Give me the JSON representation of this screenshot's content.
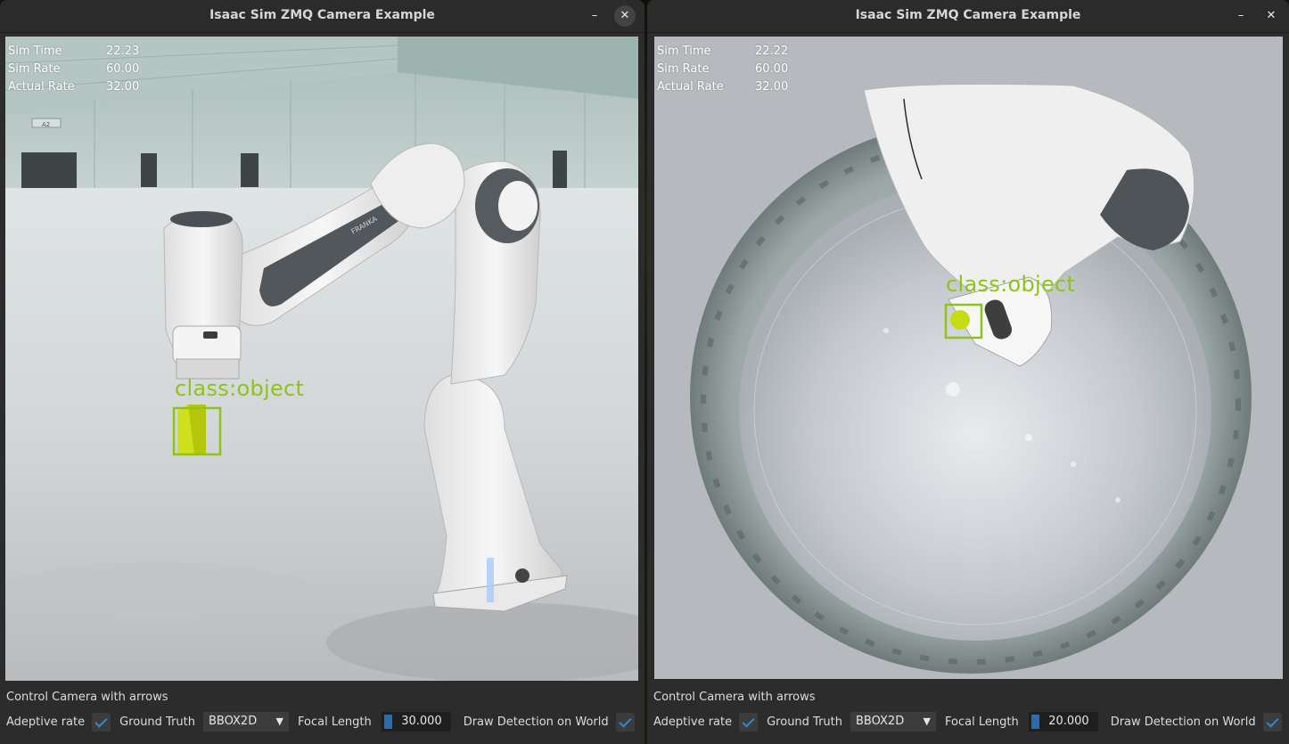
{
  "windows": [
    {
      "title": "Isaac Sim ZMQ Camera Example",
      "minimize_icon": "–",
      "close_icon": "✕",
      "stats": {
        "sim_time_label": "Sim Time",
        "sim_time": "22.23",
        "sim_rate_label": "Sim Rate",
        "sim_rate": "60.00",
        "actual_rate_label": "Actual Rate",
        "actual_rate": "32.00"
      },
      "scene_sign": "A2",
      "robot_brand": "FRANKA",
      "detection_label": "class:object",
      "controls": {
        "title": "Control Camera with arrows",
        "adaptive_rate_label": "Adeptive rate",
        "adaptive_rate_checked": true,
        "ground_truth_label": "Ground Truth",
        "ground_truth_value": "BBOX2D",
        "focal_length_label": "Focal Length",
        "focal_length_value": "30.000",
        "draw_detection_label": "Draw Detection on World",
        "draw_detection_checked": true
      }
    },
    {
      "title": "Isaac Sim ZMQ Camera Example",
      "minimize_icon": "–",
      "close_icon": "✕",
      "stats": {
        "sim_time_label": "Sim Time",
        "sim_time": "22.22",
        "sim_rate_label": "Sim Rate",
        "sim_rate": "60.00",
        "actual_rate_label": "Actual Rate",
        "actual_rate": "32.00"
      },
      "detection_label": "class:object",
      "controls": {
        "title": "Control Camera with arrows",
        "adaptive_rate_label": "Adeptive rate",
        "adaptive_rate_checked": true,
        "ground_truth_label": "Ground Truth",
        "ground_truth_value": "BBOX2D",
        "focal_length_label": "Focal Length",
        "focal_length_value": "20.000",
        "draw_detection_label": "Draw Detection on World",
        "draw_detection_checked": true
      }
    }
  ],
  "colors": {
    "detection": "#8fc31a",
    "checkbox_check": "#2a8ad8",
    "slider_fill": "#2a6cad"
  },
  "icons": {
    "combo_arrow": "▼"
  }
}
